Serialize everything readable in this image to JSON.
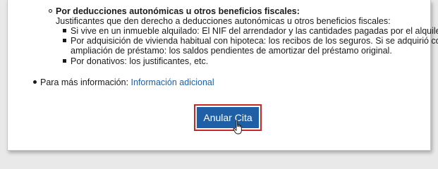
{
  "section": {
    "title": "Por deducciones autonómicas u otros beneficios fiscales:",
    "description": "Justificantes que den derecho a deducciones autonómicas u otros beneficios fiscales:",
    "items": [
      {
        "lines": [
          "Si vive en un inmueble alquilado: El NIF del arrendador y las cantidades pagadas por el alquiler."
        ]
      },
      {
        "lines": [
          "Por adquisición de vivienda habitual con hipoteca: los recibos de los seguros. Si se adquirió con",
          "ampliación de préstamo: los saldos pendientes de amortizar del préstamo original."
        ]
      },
      {
        "lines": [
          "Por donativos: los justificantes, etc."
        ]
      }
    ]
  },
  "more_info": {
    "label": "Para más información: ",
    "link_text": "Información adicional"
  },
  "actions": {
    "cancel_appointment_label": "Anular Cita"
  },
  "colors": {
    "link": "#1a5fa3",
    "button": "#1f5fa6",
    "button_focus_border": "#c62828"
  },
  "icons": {
    "cursor": "hand-pointer-icon"
  }
}
